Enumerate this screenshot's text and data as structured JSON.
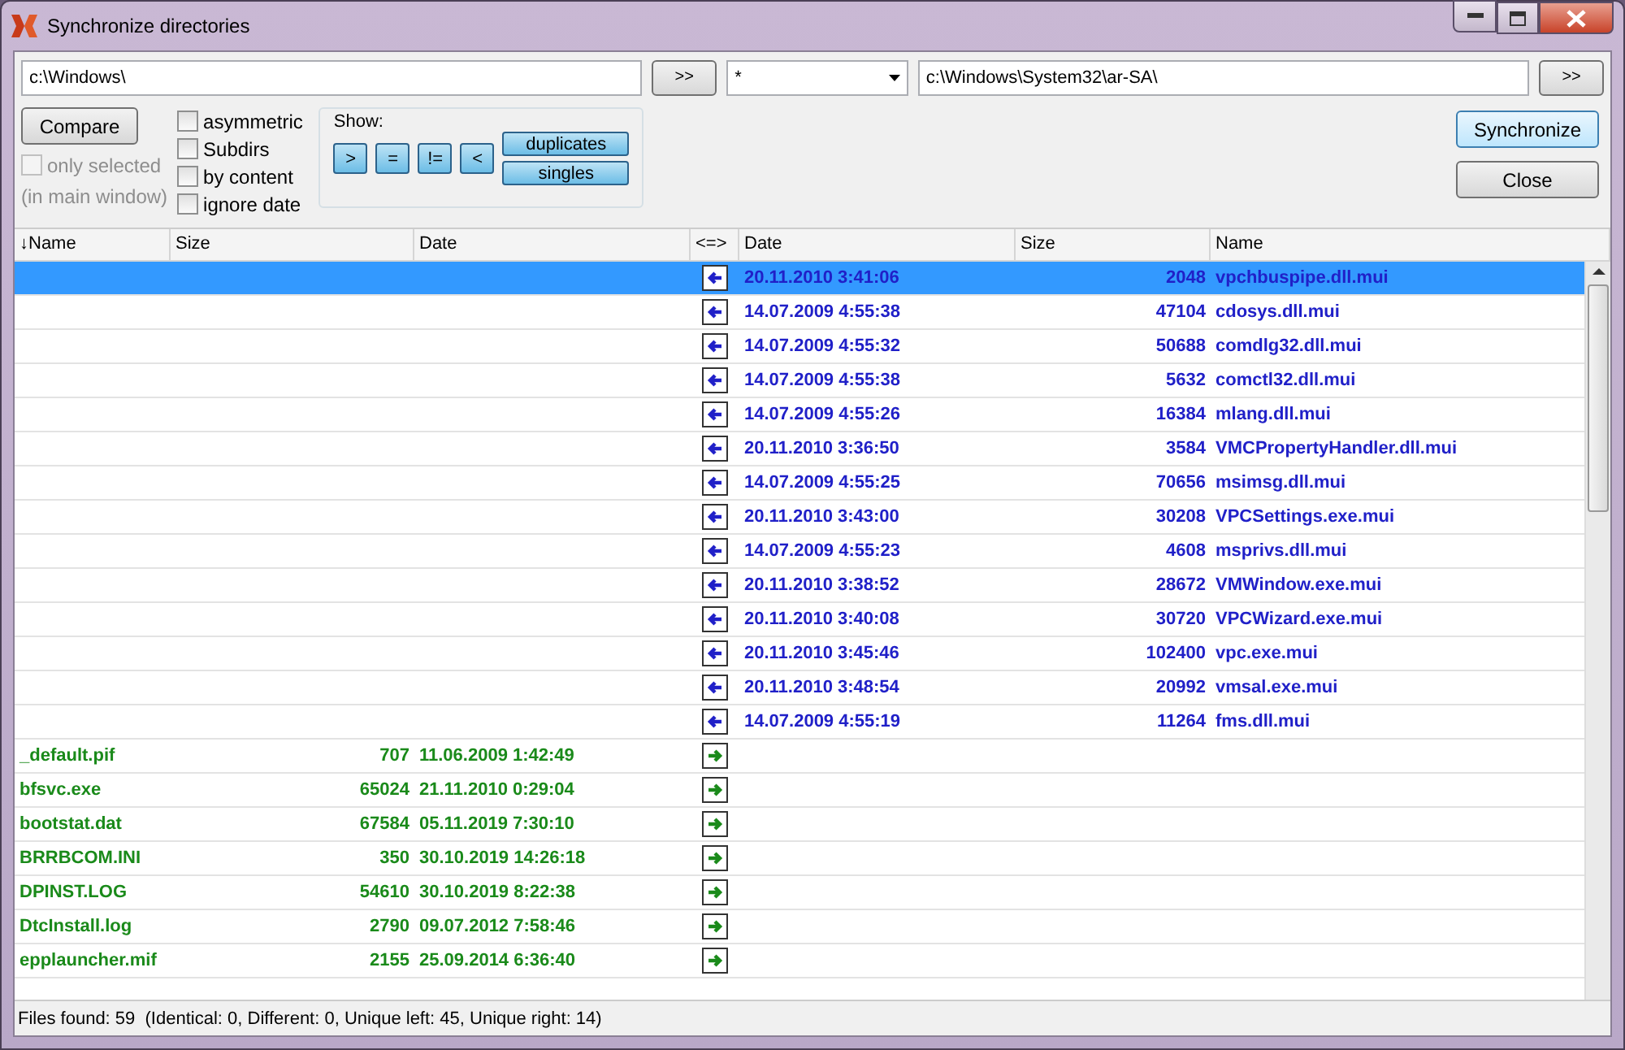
{
  "window": {
    "title": "Synchronize directories"
  },
  "left_path": {
    "value": "c:\\Windows\\"
  },
  "left_browse": {
    "label": ">>"
  },
  "filter": {
    "value": "*"
  },
  "right_path": {
    "value": "c:\\Windows\\System32\\ar-SA\\"
  },
  "right_browse": {
    "label": ">>"
  },
  "compare_button": {
    "label": "Compare"
  },
  "only_selected": {
    "label": "only selected",
    "checked": false,
    "disabled": true
  },
  "only_selected_note": "(in main window)",
  "options": [
    {
      "label": "asymmetric",
      "checked": false
    },
    {
      "label": "Subdirs",
      "checked": false
    },
    {
      "label": "by content",
      "checked": false
    },
    {
      "label": "ignore date",
      "checked": false
    }
  ],
  "show": {
    "label": "Show:",
    "small_buttons": [
      {
        "label": ">",
        "selected": true
      },
      {
        "label": "=",
        "selected": true
      },
      {
        "label": "!=",
        "selected": true
      },
      {
        "label": "<",
        "selected": true
      }
    ],
    "wide_buttons": [
      {
        "label": "duplicates",
        "selected": true
      },
      {
        "label": "singles",
        "selected": true
      }
    ]
  },
  "synchronize_button": {
    "label": "Synchronize"
  },
  "close_button": {
    "label": "Close"
  },
  "table": {
    "columns": [
      "↓Name",
      "Size",
      "Date",
      "<=>",
      "Date",
      "Size",
      "Name"
    ],
    "rows": [
      {
        "kind": "right",
        "selected": true,
        "date": "20.11.2010 3:41:06",
        "size": "2048",
        "name": "vpchbuspipe.dll.mui"
      },
      {
        "kind": "right",
        "selected": false,
        "date": "14.07.2009 4:55:38",
        "size": "47104",
        "name": "cdosys.dll.mui"
      },
      {
        "kind": "right",
        "selected": false,
        "date": "14.07.2009 4:55:32",
        "size": "50688",
        "name": "comdlg32.dll.mui"
      },
      {
        "kind": "right",
        "selected": false,
        "date": "14.07.2009 4:55:38",
        "size": "5632",
        "name": "comctl32.dll.mui"
      },
      {
        "kind": "right",
        "selected": false,
        "date": "14.07.2009 4:55:26",
        "size": "16384",
        "name": "mlang.dll.mui"
      },
      {
        "kind": "right",
        "selected": false,
        "date": "20.11.2010 3:36:50",
        "size": "3584",
        "name": "VMCPropertyHandler.dll.mui"
      },
      {
        "kind": "right",
        "selected": false,
        "date": "14.07.2009 4:55:25",
        "size": "70656",
        "name": "msimsg.dll.mui"
      },
      {
        "kind": "right",
        "selected": false,
        "date": "20.11.2010 3:43:00",
        "size": "30208",
        "name": "VPCSettings.exe.mui"
      },
      {
        "kind": "right",
        "selected": false,
        "date": "14.07.2009 4:55:23",
        "size": "4608",
        "name": "msprivs.dll.mui"
      },
      {
        "kind": "right",
        "selected": false,
        "date": "20.11.2010 3:38:52",
        "size": "28672",
        "name": "VMWindow.exe.mui"
      },
      {
        "kind": "right",
        "selected": false,
        "date": "20.11.2010 3:40:08",
        "size": "30720",
        "name": "VPCWizard.exe.mui"
      },
      {
        "kind": "right",
        "selected": false,
        "date": "20.11.2010 3:45:46",
        "size": "102400",
        "name": "vpc.exe.mui"
      },
      {
        "kind": "right",
        "selected": false,
        "date": "20.11.2010 3:48:54",
        "size": "20992",
        "name": "vmsal.exe.mui"
      },
      {
        "kind": "right",
        "selected": false,
        "date": "14.07.2009 4:55:19",
        "size": "11264",
        "name": "fms.dll.mui"
      },
      {
        "kind": "left",
        "selected": false,
        "name": "_default.pif",
        "size": "707",
        "date": "11.06.2009 1:42:49"
      },
      {
        "kind": "left",
        "selected": false,
        "name": "bfsvc.exe",
        "size": "65024",
        "date": "21.11.2010 0:29:04"
      },
      {
        "kind": "left",
        "selected": false,
        "name": "bootstat.dat",
        "size": "67584",
        "date": "05.11.2019 7:30:10"
      },
      {
        "kind": "left",
        "selected": false,
        "name": "BRRBCOM.INI",
        "size": "350",
        "date": "30.10.2019 14:26:18"
      },
      {
        "kind": "left",
        "selected": false,
        "name": "DPINST.LOG",
        "size": "54610",
        "date": "30.10.2019 8:22:38"
      },
      {
        "kind": "left",
        "selected": false,
        "name": "DtcInstall.log",
        "size": "2790",
        "date": "09.07.2012 7:58:46"
      },
      {
        "kind": "left",
        "selected": false,
        "name": "epplauncher.mif",
        "size": "2155",
        "date": "25.09.2014 6:36:40"
      }
    ]
  },
  "status_bar": "Files found: 59  (Identical: 0, Different: 0, Unique left: 45, Unique right: 14)"
}
